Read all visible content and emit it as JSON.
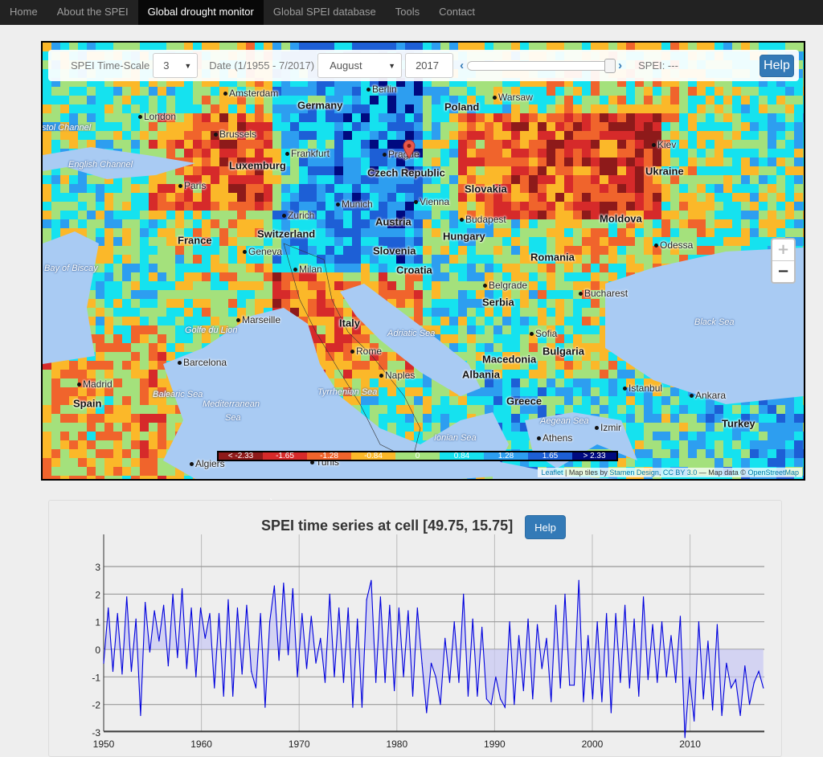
{
  "nav": {
    "items": [
      {
        "label": "Home"
      },
      {
        "label": "About the SPEI"
      },
      {
        "label": "Global drought monitor",
        "active": true
      },
      {
        "label": "Global SPEI database"
      },
      {
        "label": "Tools"
      },
      {
        "label": "Contact"
      }
    ]
  },
  "controls": {
    "timescale_label": "SPEI Time-Scale",
    "timescale_value": "3",
    "date_label": "Date (1/1955 - 7/2017)",
    "month_value": "August",
    "year_value": "2017",
    "slider_position": 1.0,
    "spei_readout": "SPEI: ---",
    "help_label": "Help",
    "prev_icon": "chevron-left-icon",
    "next_icon": "chevron-right-icon"
  },
  "map": {
    "zoom_in": "+",
    "zoom_out": "−",
    "marker": "Prague",
    "labels": [
      {
        "t": "Berlin",
        "k": "city"
      },
      {
        "t": "Amsterdam",
        "k": "city"
      },
      {
        "t": "Warsaw",
        "k": "city"
      },
      {
        "t": "Germany",
        "k": "country"
      },
      {
        "t": "Poland",
        "k": "country"
      },
      {
        "t": "London",
        "k": "city"
      },
      {
        "t": "Brussels",
        "k": "city"
      },
      {
        "t": "Frankfurt",
        "k": "city"
      },
      {
        "t": "Prague",
        "k": "city"
      },
      {
        "t": "Kiev",
        "k": "city"
      },
      {
        "t": "Luxemburg",
        "k": "country"
      },
      {
        "t": "Czech Republic",
        "k": "country"
      },
      {
        "t": "Ukraine",
        "k": "country"
      },
      {
        "t": "English Channel",
        "k": "sea"
      },
      {
        "t": "Paris",
        "k": "city"
      },
      {
        "t": "Slovakia",
        "k": "country"
      },
      {
        "t": "Munich",
        "k": "city"
      },
      {
        "t": "Vienna",
        "k": "city"
      },
      {
        "t": "Zurich",
        "k": "city"
      },
      {
        "t": "Budapest",
        "k": "city"
      },
      {
        "t": "Moldova",
        "k": "country"
      },
      {
        "t": "Austria",
        "k": "country"
      },
      {
        "t": "Switzerland",
        "k": "country"
      },
      {
        "t": "Hungary",
        "k": "country"
      },
      {
        "t": "France",
        "k": "country"
      },
      {
        "t": "Odessa",
        "k": "city"
      },
      {
        "t": "Geneva",
        "k": "city"
      },
      {
        "t": "Slovenia",
        "k": "country"
      },
      {
        "t": "Romania",
        "k": "country"
      },
      {
        "t": "Milan",
        "k": "city"
      },
      {
        "t": "Croatia",
        "k": "country"
      },
      {
        "t": "Bay of Biscay",
        "k": "sea"
      },
      {
        "t": "Belgrade",
        "k": "city"
      },
      {
        "t": "Bucharest",
        "k": "city"
      },
      {
        "t": "Serbia",
        "k": "country"
      },
      {
        "t": "Marseille",
        "k": "city"
      },
      {
        "t": "Italy",
        "k": "country"
      },
      {
        "t": "Black Sea",
        "k": "sea"
      },
      {
        "t": "Golfe du Lion",
        "k": "sea"
      },
      {
        "t": "Adriatic Sea",
        "k": "sea"
      },
      {
        "t": "Sofia",
        "k": "city"
      },
      {
        "t": "Bulgaria",
        "k": "country"
      },
      {
        "t": "Rome",
        "k": "city"
      },
      {
        "t": "Macedonia",
        "k": "country"
      },
      {
        "t": "Barcelona",
        "k": "city"
      },
      {
        "t": "Albania",
        "k": "country"
      },
      {
        "t": "Naples",
        "k": "city"
      },
      {
        "t": "Istanbul",
        "k": "city"
      },
      {
        "t": "Tyrrhenian Sea",
        "k": "sea"
      },
      {
        "t": "Ankara",
        "k": "city"
      },
      {
        "t": "Madrid",
        "k": "city"
      },
      {
        "t": "Balearic Sea",
        "k": "sea"
      },
      {
        "t": "Greece",
        "k": "country"
      },
      {
        "t": "Spain",
        "k": "country"
      },
      {
        "t": "Mediterranean",
        "k": "sea"
      },
      {
        "t": "Sea",
        "k": "sea"
      },
      {
        "t": "Aegean Sea",
        "k": "sea"
      },
      {
        "t": "Izmir",
        "k": "city"
      },
      {
        "t": "Turkey",
        "k": "country"
      },
      {
        "t": "Ionian Sea",
        "k": "sea"
      },
      {
        "t": "Athens",
        "k": "city"
      },
      {
        "t": "Algiers",
        "k": "city"
      },
      {
        "t": "Tunis",
        "k": "city"
      },
      {
        "t": "stol Channel",
        "k": "sea"
      }
    ],
    "legend": [
      {
        "label": "< -2.33",
        "color": "#8e1a1a"
      },
      {
        "label": "-1.65",
        "color": "#d62a2a"
      },
      {
        "label": "-1.28",
        "color": "#f0642c"
      },
      {
        "label": "-0.84",
        "color": "#fbb829"
      },
      {
        "label": "0",
        "color": "#a4e17c"
      },
      {
        "label": "0.84",
        "color": "#15e2ef"
      },
      {
        "label": "1.28",
        "color": "#2d9ef0"
      },
      {
        "label": "1.65",
        "color": "#1d5fd6"
      },
      {
        "label": "> 2.33",
        "color": "#000a80"
      }
    ],
    "attribution": {
      "leaflet": "Leaflet",
      "sep1": " | Map tiles by ",
      "stamen": "Stamen Design",
      "sep2": ", ",
      "cc": "CC BY 3.0",
      "sep3": " — Map data © ",
      "osm": "OpenStreetMap"
    }
  },
  "chart_section": {
    "title": "SPEI time series at cell [49.75, 15.75]",
    "help_label": "Help"
  },
  "chart_data": {
    "type": "line",
    "title": "SPEI time series at cell [49.75, 15.75]",
    "xlabel": "",
    "ylabel": "",
    "xlim": [
      1950,
      2017.6
    ],
    "ylim": [
      -3,
      4
    ],
    "xticks": [
      1950,
      1960,
      1970,
      1980,
      1990,
      2000,
      2010
    ],
    "yticks": [
      -3,
      -2,
      -1,
      0,
      1,
      2,
      3
    ],
    "grid": true,
    "line_color": "#0000dd",
    "fill_color": "#c8c8f4",
    "x_start": 1950,
    "x_end": 2017.5,
    "values": [
      -0.5,
      1.5,
      -0.8,
      1.3,
      -0.9,
      1.9,
      -0.8,
      1.1,
      -2.4,
      1.7,
      -0.1,
      1.4,
      0.3,
      1.6,
      -0.6,
      2.0,
      -0.3,
      2.2,
      -0.7,
      1.5,
      -1.0,
      1.5,
      0.4,
      1.3,
      -1.4,
      1.3,
      -1.7,
      1.8,
      -1.7,
      1.5,
      -0.9,
      1.6,
      -0.8,
      -1.4,
      1.3,
      -2.1,
      1.0,
      2.3,
      -0.4,
      2.4,
      -0.2,
      2.2,
      -1.0,
      1.3,
      -0.7,
      1.2,
      -0.5,
      0.4,
      -1.2,
      2.0,
      -1.0,
      1.5,
      -1.2,
      1.5,
      -2.1,
      1.1,
      -2.1,
      1.8,
      2.5,
      -1.2,
      1.9,
      -1.2,
      1.6,
      -1.5,
      1.5,
      -1.0,
      1.4,
      -1.7,
      1.5,
      -0.5,
      -2.3,
      -0.5,
      -1.0,
      -2.0,
      0.4,
      -1.2,
      1.0,
      -1.2,
      2.0,
      -1.7,
      1.1,
      -1.7,
      0.8,
      -1.8,
      -2.0,
      -1.0,
      -1.8,
      -2.1,
      1.0,
      -2.0,
      0.5,
      -1.5,
      1.1,
      -1.8,
      0.9,
      -0.7,
      0.4,
      -1.9,
      1.6,
      -1.4,
      2.0,
      -1.3,
      -1.3,
      2.5,
      -1.9,
      0.5,
      -1.8,
      1.0,
      -1.9,
      1.3,
      -2.3,
      1.3,
      -1.2,
      1.6,
      -1.4,
      1.1,
      -1.7,
      1.9,
      -1.1,
      0.9,
      -1.2,
      1.0,
      -1.0,
      0.5,
      -1.2,
      1.2,
      -3.2,
      -1.0,
      -2.6,
      1.0,
      -1.8,
      0.3,
      -2.2,
      0.9,
      -2.4,
      -0.5,
      -1.4,
      -1.1,
      -2.4,
      -0.6,
      -2.0,
      -1.2,
      -0.8,
      -1.4
    ]
  }
}
